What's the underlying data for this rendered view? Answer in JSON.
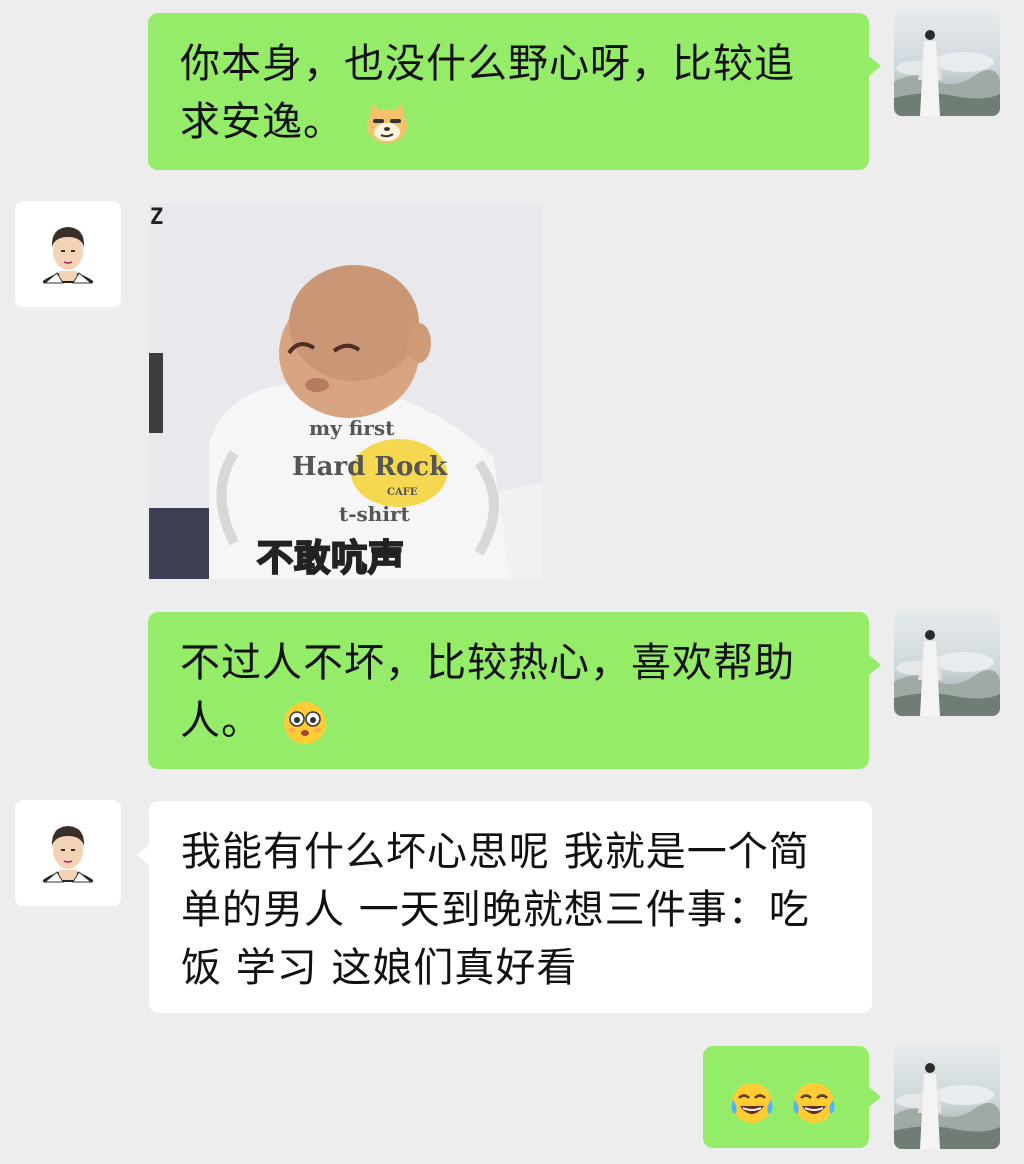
{
  "messages": [
    {
      "sender": "me",
      "text": "你本身，也没什么野心呀，比较追求安逸。",
      "line1": "你本身，也没什么野心呀，比较追",
      "line2": "求安逸。",
      "emoji": "smug-doge-emoji"
    },
    {
      "sender": "other",
      "type": "sticker",
      "sticker_caption": "不敢吭声",
      "shirt_text": {
        "top": "my first",
        "middle": "Hard Rock",
        "small": "CAFE",
        "bottom": "t-shirt"
      },
      "corner_mark": "Z"
    },
    {
      "sender": "me",
      "text": "不过人不坏，比较热心，喜欢帮助人。",
      "line1": "不过人不坏，比较热心，喜欢帮助",
      "line2": "人。",
      "emoji": "flushed-face-emoji"
    },
    {
      "sender": "other",
      "text": "我能有什么坏心思呢 我就是一个简单的男人 一天到晚就想三件事：吃饭 学习 这娘们真好看",
      "line1": "我能有什么坏心思呢 我就是一个简",
      "line2": "单的男人 一天到晚就想三件事：吃",
      "line3": "饭 学习 这娘们真好看"
    },
    {
      "sender": "me",
      "type": "emoji-only",
      "emojis": [
        "tears-of-joy-emoji",
        "tears-of-joy-emoji"
      ]
    }
  ],
  "colors": {
    "background": "#ededed",
    "my_bubble": "#95ec69",
    "other_bubble": "#ffffff"
  }
}
